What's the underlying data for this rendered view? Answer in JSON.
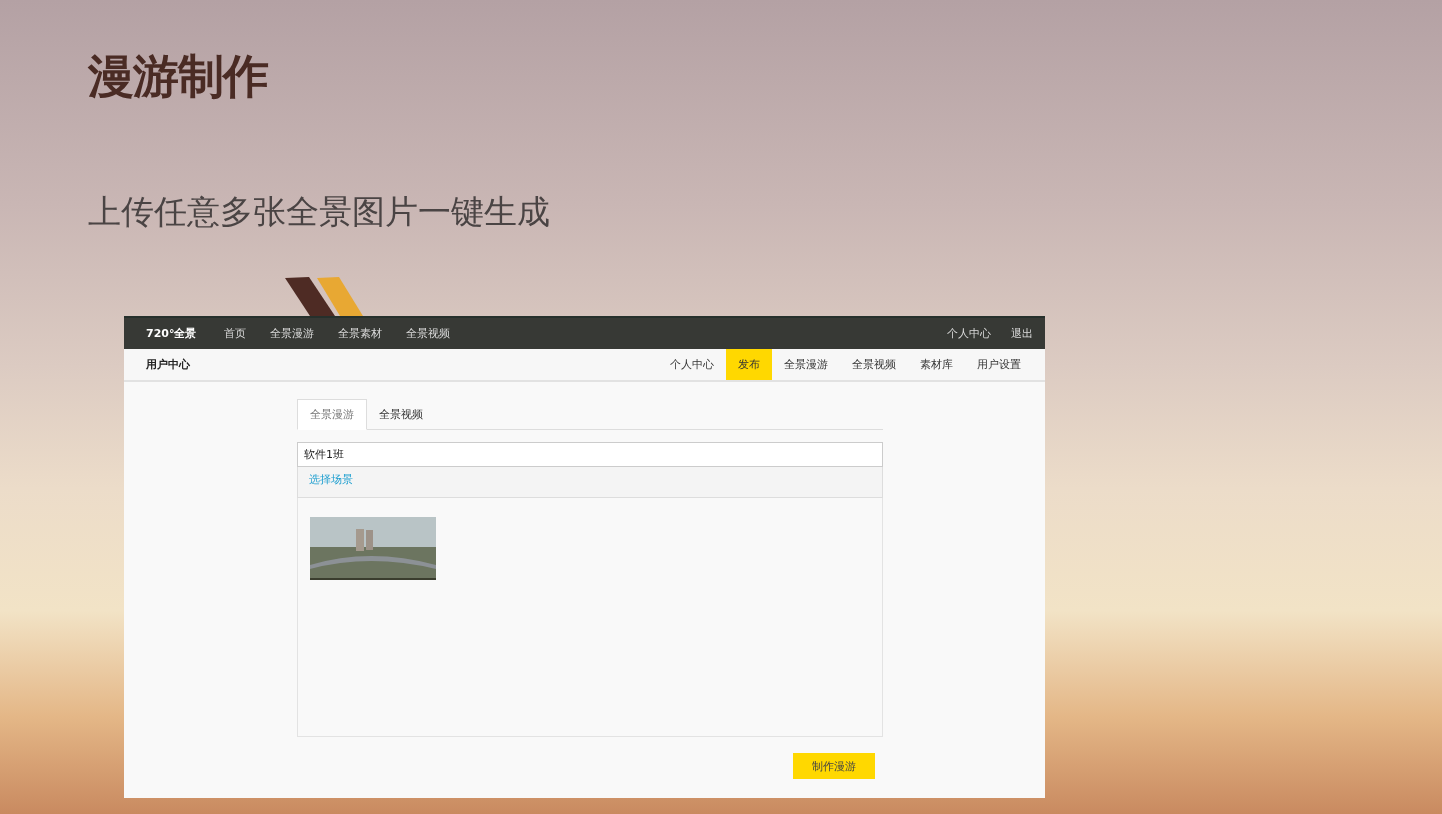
{
  "slide": {
    "title": "漫游制作",
    "subtitle": "上传任意多张全景图片一键生成"
  },
  "screenshot": {
    "top_nav": {
      "logo": "720°全景",
      "links": [
        "首页",
        "全景漫游",
        "全景素材",
        "全景视频"
      ],
      "right_links": [
        "个人中心",
        "退出"
      ]
    },
    "sub_nav": {
      "title": "用户中心",
      "items": [
        {
          "label": "个人中心",
          "selected": false
        },
        {
          "label": "发布",
          "selected": true
        },
        {
          "label": "全景漫游",
          "selected": false
        },
        {
          "label": "全景视频",
          "selected": false
        },
        {
          "label": "素材库",
          "selected": false
        },
        {
          "label": "用户设置",
          "selected": false
        }
      ]
    },
    "tabs": [
      {
        "label": "全景漫游",
        "selected": true
      },
      {
        "label": "全景视频",
        "selected": false
      }
    ],
    "name_field": {
      "value": "软件1班"
    },
    "select_scene_link": "选择场景",
    "submit_button": "制作漫游"
  }
}
